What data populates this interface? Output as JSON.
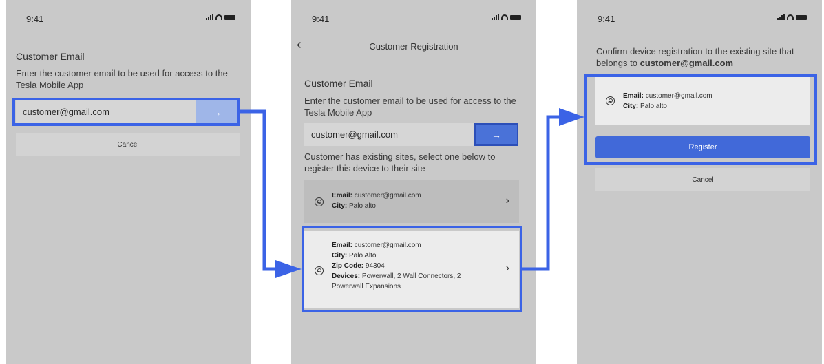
{
  "status_bar": {
    "time": "9:41"
  },
  "screen1": {
    "heading": "Customer Email",
    "description": "Enter the customer email to be used for access to the Tesla Mobile App",
    "email_value": "customer@gmail.com",
    "submit_icon": "→",
    "cancel_label": "Cancel"
  },
  "screen2": {
    "back_icon": "‹",
    "title": "Customer Registration",
    "heading": "Customer Email",
    "description": "Enter the customer email to be used for access to the Tesla Mobile App",
    "email_value": "customer@gmail.com",
    "submit_icon": "→",
    "sites_prompt": "Customer has existing sites, select one below to register this device to their site",
    "sites": [
      {
        "email_label": "Email:",
        "email": "customer@gmail.com",
        "city_label": "City:",
        "city": "Palo alto"
      },
      {
        "email_label": "Email:",
        "email": "customer@gmail.com",
        "city_label": "City:",
        "city": "Palo Alto",
        "zip_label": "Zip Code:",
        "zip": "94304",
        "devices_label": "Devices:",
        "devices_line1": "Powerwall, 2 Wall Connectors, 2",
        "devices_line2": "Powerwall Expansions"
      }
    ],
    "chevron_icon": "›"
  },
  "screen3": {
    "confirm_text": "Confirm device registration to the existing site that belongs to",
    "confirm_email": "customer@gmail.com",
    "site": {
      "email_label": "Email:",
      "email": "customer@gmail.com",
      "city_label": "City:",
      "city": "Palo alto"
    },
    "register_label": "Register",
    "cancel_label": "Cancel"
  },
  "icons": [
    "signal-icon",
    "wifi-icon",
    "battery-icon",
    "back-chevron-icon",
    "arrow-right-icon",
    "user-circle-icon",
    "chevron-right-icon"
  ],
  "colors": {
    "phone_bg": "#c9c9c9",
    "highlight": "#3b63e6",
    "register_button": "#4169d9",
    "arrow_button": "#9fb6e8"
  }
}
